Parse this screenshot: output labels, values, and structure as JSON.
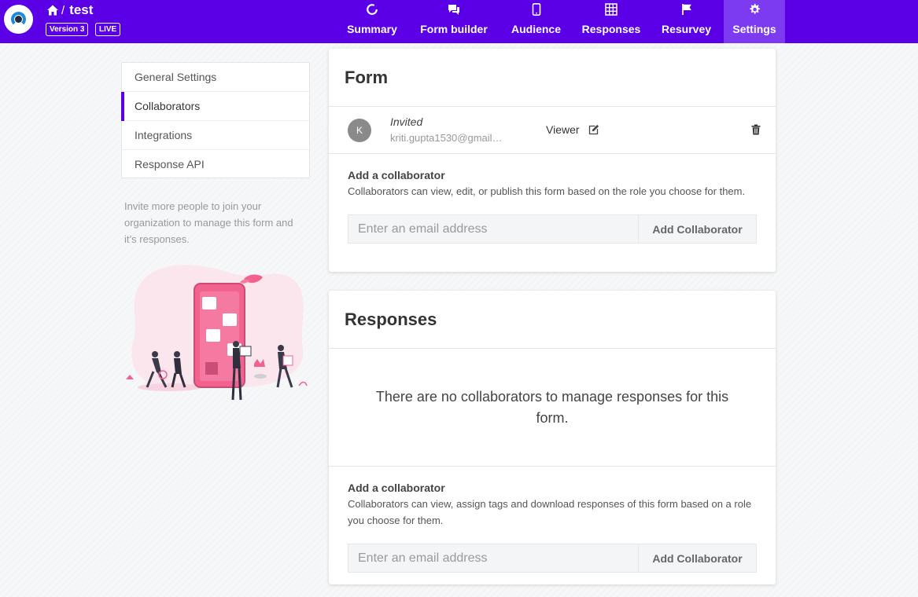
{
  "header": {
    "title": "test",
    "version_badge": "Version 3",
    "live_badge": "LIVE",
    "nav": [
      {
        "label": "Summary",
        "icon": "summary-icon"
      },
      {
        "label": "Form builder",
        "icon": "form-builder-icon"
      },
      {
        "label": "Audience",
        "icon": "audience-icon"
      },
      {
        "label": "Responses",
        "icon": "responses-icon"
      },
      {
        "label": "Resurvey",
        "icon": "flag-icon"
      },
      {
        "label": "Settings",
        "icon": "gear-icon",
        "active": true
      }
    ]
  },
  "sidebar": {
    "items": [
      {
        "label": "General Settings"
      },
      {
        "label": "Collaborators",
        "active": true
      },
      {
        "label": "Integrations"
      },
      {
        "label": "Response API"
      }
    ],
    "invite_text": "Invite more people to join your organization to manage this form and it’s responses."
  },
  "form_card": {
    "title": "Form",
    "collaborator": {
      "initial": "K",
      "status": "Invited",
      "email": "kriti.gupta1530@gmail…",
      "role": "Viewer"
    },
    "add": {
      "title": "Add a collaborator",
      "description": "Collaborators can view, edit, or publish this form based on the role you choose for them.",
      "placeholder": "Enter an email address",
      "button": "Add Collaborator"
    }
  },
  "responses_card": {
    "title": "Responses",
    "empty_message": "There are no collaborators to manage responses for this form.",
    "add": {
      "title": "Add a collaborator",
      "description": "Collaborators can view, assign tags and download responses of this form based on a role you choose for them.",
      "placeholder": "Enter an email address",
      "button": "Add Collaborator"
    }
  },
  "colors": {
    "brand": "#5b00e6",
    "active_tab": "#7c3bf0",
    "illustration_pink": "#f3628f"
  }
}
